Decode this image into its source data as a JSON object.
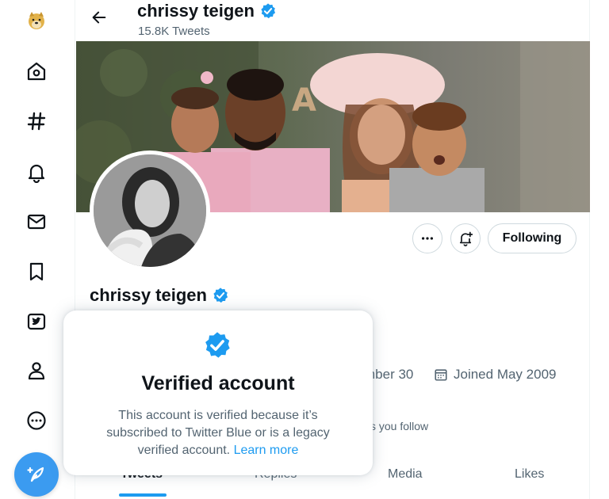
{
  "header": {
    "display_name": "chrissy teigen",
    "tweet_count": "15.8K Tweets"
  },
  "profile": {
    "display_name": "chrissy teigen",
    "handle_fragment": "",
    "birthday_fragment": "mber 30",
    "joined": "Joined May 2009",
    "followers_fragment": "s you follow",
    "following_label": "Following"
  },
  "tabs": [
    {
      "label": "Tweets",
      "active": true
    },
    {
      "label": "Replies",
      "active": false
    },
    {
      "label": "Media",
      "active": false
    },
    {
      "label": "Likes",
      "active": false
    }
  ],
  "popup": {
    "title": "Verified account",
    "body": "This account is verified because it’s subscribed to Twitter Blue or is a legacy verified account.",
    "link": "Learn more"
  },
  "nav": {
    "items": [
      "doge-logo-icon",
      "home-icon",
      "explore-hashtag-icon",
      "notifications-bell-icon",
      "messages-envelope-icon",
      "bookmarks-icon",
      "twitter-blue-icon",
      "profile-person-icon",
      "more-circle-icon"
    ],
    "compose": "compose-feather-icon"
  },
  "colors": {
    "accent": "#1d9bf0",
    "verified_badge": "#1d9bf0",
    "fab": "#3b9bf0",
    "secondary_text": "#536471"
  }
}
